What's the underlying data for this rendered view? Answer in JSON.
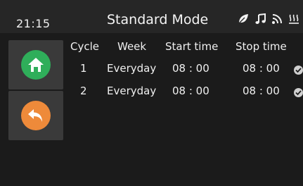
{
  "header": {
    "clock": "21:15",
    "title": "Standard Mode",
    "status_icons": [
      "leaf-icon",
      "music-note-icon",
      "wifi-icon",
      "heater-icon"
    ]
  },
  "sidebar": {
    "items": [
      {
        "name": "home",
        "icon": "home-icon",
        "color": "#2fae5a"
      },
      {
        "name": "back",
        "icon": "back-arrow-icon",
        "color": "#ee8a3a"
      }
    ]
  },
  "schedule": {
    "columns": [
      "Cycle",
      "Week",
      "Start time",
      "Stop time"
    ],
    "rows": [
      {
        "cycle": "1",
        "week": "Everyday",
        "start": "08 : 00",
        "stop": "08 : 00",
        "enabled": true
      },
      {
        "cycle": "2",
        "week": "Everyday",
        "start": "08 : 00",
        "stop": "08 : 00",
        "enabled": true
      }
    ]
  },
  "colors": {
    "background": "#1b1b1b",
    "topbar": "#262626",
    "button": "#3a3a3a",
    "check": "#cfcfcf"
  }
}
